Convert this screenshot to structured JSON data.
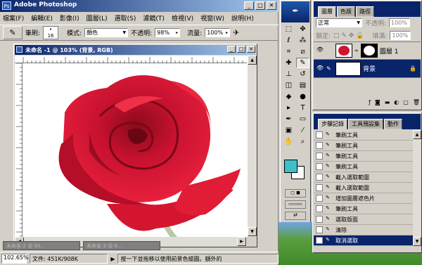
{
  "app": {
    "title": "Adobe Photoshop",
    "menu": [
      "檔案(F)",
      "編輯(E)",
      "影像(I)",
      "圖層(L)",
      "選取(S)",
      "濾鏡(T)",
      "檢視(V)",
      "視窗(W)",
      "說明(H)"
    ],
    "window_controls": {
      "minimize": "_",
      "maximize": "□",
      "close": "✕"
    }
  },
  "options": {
    "brush_label": "筆刷:",
    "brush_size": "16",
    "mode_label": "模式:",
    "mode_value": "顏色",
    "opacity_label": "不透明:",
    "opacity_value": "98%",
    "flow_label": "流量:",
    "flow_value": "100%"
  },
  "document": {
    "title": "未命名 -1 @ 103% (背景, RGB)",
    "ruler_marks": [
      "0",
      "1",
      "2",
      "3",
      "4",
      "5",
      "6",
      "7",
      "8",
      "9",
      "10",
      "11"
    ]
  },
  "minimized_docs": [
    "未命名-2 @ 50...",
    "未命名-3 @ 6..."
  ],
  "status": {
    "zoom": "102.65%",
    "doc_size": "文件: 451K/908K",
    "hint": "按一下並拖移以使用前景色繪圖。額外的"
  },
  "colors": {
    "foreground": "#3cc1c9",
    "background": "#ffffff",
    "rose": "#d0142f"
  },
  "layers_panel": {
    "tabs": [
      "圖層",
      "色版",
      "路徑"
    ],
    "blend_mode": "正常",
    "opacity_label": "不透明:",
    "opacity_value": "100%",
    "lock_label": "鎖定:",
    "fill_label": "填滿:",
    "fill_value": "100%",
    "layers": [
      {
        "name": "圖層 1",
        "has_mask": true,
        "selected": false
      },
      {
        "name": "背景",
        "has_mask": false,
        "selected": true,
        "locked": true
      }
    ]
  },
  "history_panel": {
    "tabs": [
      "步驟記錄",
      "工具預設集",
      "動作"
    ],
    "items": [
      {
        "label": "筆刷工具",
        "selected": false
      },
      {
        "label": "筆刷工具",
        "selected": false
      },
      {
        "label": "筆刷工具",
        "selected": false
      },
      {
        "label": "筆刷工具",
        "selected": false
      },
      {
        "label": "載入選取範圍",
        "selected": false
      },
      {
        "label": "載入選取範圍",
        "selected": false
      },
      {
        "label": "增加圖層遮色片",
        "selected": false
      },
      {
        "label": "筆刷工具",
        "selected": false
      },
      {
        "label": "選取版面",
        "selected": false
      },
      {
        "label": "清除",
        "selected": false
      },
      {
        "label": "取消選取",
        "selected": true
      }
    ]
  },
  "tools": [
    {
      "name": "marquee-icon",
      "glyph": "⬚"
    },
    {
      "name": "move-icon",
      "glyph": "✥"
    },
    {
      "name": "lasso-icon",
      "glyph": "ℓ"
    },
    {
      "name": "magic-wand-icon",
      "glyph": "⁂"
    },
    {
      "name": "crop-icon",
      "glyph": "⌗"
    },
    {
      "name": "slice-icon",
      "glyph": "⧄"
    },
    {
      "name": "healing-icon",
      "glyph": "✚"
    },
    {
      "name": "brush-icon",
      "glyph": "✎"
    },
    {
      "name": "stamp-icon",
      "glyph": "⊥"
    },
    {
      "name": "history-brush-icon",
      "glyph": "↺"
    },
    {
      "name": "eraser-icon",
      "glyph": "◫"
    },
    {
      "name": "gradient-icon",
      "glyph": "▤"
    },
    {
      "name": "blur-icon",
      "glyph": "◆"
    },
    {
      "name": "dodge-icon",
      "glyph": "●"
    },
    {
      "name": "path-select-icon",
      "glyph": "▸"
    },
    {
      "name": "type-icon",
      "glyph": "T"
    },
    {
      "name": "pen-icon",
      "glyph": "✒"
    },
    {
      "name": "shape-icon",
      "glyph": "▭"
    },
    {
      "name": "notes-icon",
      "glyph": "▣"
    },
    {
      "name": "eyedropper-icon",
      "glyph": "⁄"
    },
    {
      "name": "hand-icon",
      "glyph": "✋"
    },
    {
      "name": "zoom-icon",
      "glyph": "⌕"
    }
  ]
}
